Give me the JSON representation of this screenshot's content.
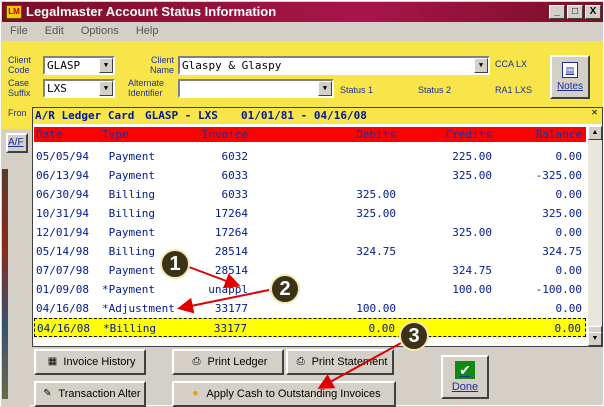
{
  "window": {
    "title": "Legalmaster Account Status Information",
    "controls": [
      "_",
      "□",
      "X"
    ]
  },
  "menu": [
    "File",
    "Edit",
    "Options",
    "Help"
  ],
  "form": {
    "client_code_label": "Client Code",
    "client_code": "GLASP",
    "case_suffix_label": "Case Suffix",
    "case_suffix": "LXS",
    "client_name_label": "Client Name",
    "client_name": "Glaspy & Glaspy",
    "alternate_identifier_label": "Alternate Identifier",
    "alternate_identifier": "",
    "status1_label": "Status 1",
    "status2_label": "Status 2",
    "code1": "CCA LX",
    "code2": "RA1 LXS",
    "from_label": "Fron",
    "ar_btn": "A/F",
    "notes_label": "Notes"
  },
  "ledger": {
    "title": "A/R Ledger Card",
    "account": "GLASP - LXS",
    "range": "01/01/81 - 04/16/08",
    "columns": [
      "Date",
      "Type",
      "Invoice",
      "Debits",
      "Credits",
      "Balance"
    ],
    "rows": [
      {
        "date": "05/05/94",
        "type": " Payment",
        "invoice": "6032",
        "debits": "",
        "credits": "225.00",
        "balance": "0.00"
      },
      {
        "date": "06/13/94",
        "type": " Payment",
        "invoice": "6033",
        "debits": "",
        "credits": "325.00",
        "balance": "-325.00"
      },
      {
        "date": "06/30/94",
        "type": " Billing",
        "invoice": "6033",
        "debits": "325.00",
        "credits": "",
        "balance": "0.00"
      },
      {
        "date": "10/31/94",
        "type": " Billing",
        "invoice": "17264",
        "debits": "325.00",
        "credits": "",
        "balance": "325.00"
      },
      {
        "date": "12/01/94",
        "type": " Payment",
        "invoice": "17264",
        "debits": "",
        "credits": "325.00",
        "balance": "0.00"
      },
      {
        "date": "05/14/98",
        "type": " Billing",
        "invoice": "28514",
        "debits": "324.75",
        "credits": "",
        "balance": "324.75"
      },
      {
        "date": "07/07/98",
        "type": " Payment",
        "invoice": "28514",
        "debits": "",
        "credits": "324.75",
        "balance": "0.00"
      },
      {
        "date": "01/09/08",
        "type": "*Payment",
        "invoice": "unappl",
        "debits": "",
        "credits": "100.00",
        "balance": "-100.00"
      },
      {
        "date": "04/16/08",
        "type": "*Adjustment",
        "invoice": "33177",
        "debits": "100.00",
        "credits": "",
        "balance": "0.00"
      },
      {
        "date": "04/16/08",
        "type": "*Billing",
        "invoice": "33177",
        "debits": "0.00",
        "credits": "",
        "balance": "0.00",
        "selected": true
      }
    ]
  },
  "buttons": {
    "invoice_history": "Invoice History",
    "print_ledger": "Print Ledger",
    "print_statement": "Print Statement",
    "transaction_alter": "Transaction Alter",
    "apply_cash": "Apply Cash to Outstanding Invoices",
    "done": "Done"
  },
  "annotations": [
    "1",
    "2",
    "3"
  ],
  "colors": {
    "title_bar": "#a8154b",
    "form_bg": "#f7e54a",
    "header_bg": "#ff0000",
    "selected_row": "#ffff00",
    "text_blue": "#001890",
    "arrow": "#e00000"
  }
}
